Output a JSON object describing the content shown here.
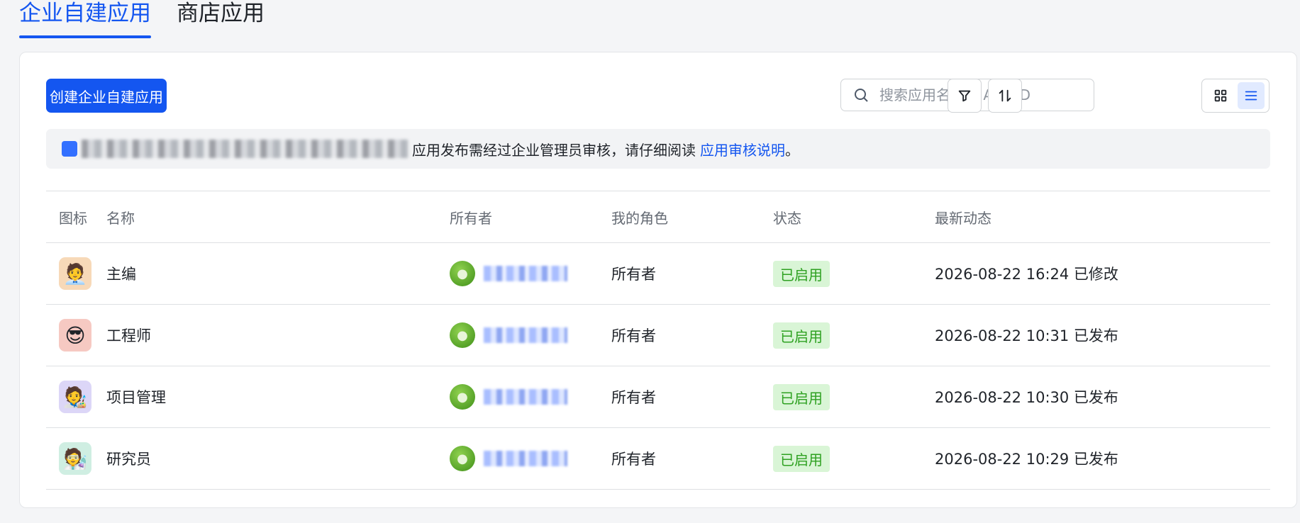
{
  "tabs": [
    {
      "label": "企业自建应用",
      "active": true
    },
    {
      "label": "商店应用",
      "active": false
    }
  ],
  "toolbar": {
    "create_label": "创建企业自建应用",
    "search_placeholder": "搜索应用名称或 App ID"
  },
  "notice": {
    "text": "应用发布需经过企业管理员审核，请仔细阅读",
    "link": "应用审核说明",
    "suffix": "。"
  },
  "table": {
    "headers": [
      "图标",
      "名称",
      "所有者",
      "我的角色",
      "状态",
      "最新动态"
    ],
    "rows": [
      {
        "avatar": "🧑‍💼",
        "avatar_bg": "#f7d9b8",
        "name": "主编",
        "role": "所有者",
        "status": "已启用",
        "activity": "2026-08-22 16:24 已修改"
      },
      {
        "avatar": "😎",
        "avatar_bg": "#f6c9c2",
        "name": "工程师",
        "role": "所有者",
        "status": "已启用",
        "activity": "2026-08-22 10:31 已发布"
      },
      {
        "avatar": "🧑‍🎨",
        "avatar_bg": "#dcd6f7",
        "name": "项目管理",
        "role": "所有者",
        "status": "已启用",
        "activity": "2026-08-22 10:30 已发布"
      },
      {
        "avatar": "🧑‍🔬",
        "avatar_bg": "#cfeee2",
        "name": "研究员",
        "role": "所有者",
        "status": "已启用",
        "activity": "2026-08-22 10:29 已发布"
      }
    ]
  },
  "colors": {
    "accent": "#1456f0",
    "status_bg": "#d9f5d6",
    "status_text": "#2ea121"
  }
}
